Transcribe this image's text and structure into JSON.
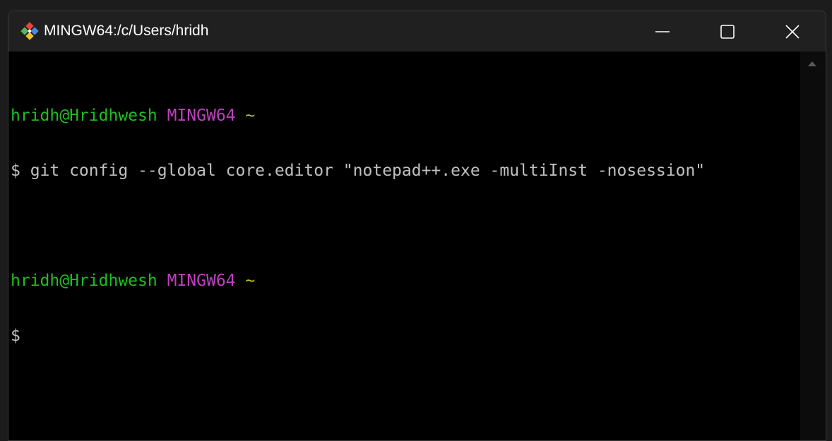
{
  "window": {
    "title": "MINGW64:/c/Users/hridh",
    "icon": "git-bash-icon"
  },
  "controls": {
    "minimize_icon": "minimize-icon",
    "maximize_icon": "maximize-icon",
    "close_icon": "close-icon"
  },
  "terminal": {
    "prompt1": {
      "user_host": "hridh@Hridhwesh",
      "space1": " ",
      "env": "MINGW64",
      "space2": " ",
      "path": "~"
    },
    "command1": "$ git config --global core.editor \"notepad++.exe -multiInst -nosession\"",
    "blank": "",
    "prompt2": {
      "user_host": "hridh@Hridhwesh",
      "space1": " ",
      "env": "MINGW64",
      "space2": " ",
      "path": "~"
    },
    "command2": "$"
  },
  "colors": {
    "user_host": "#1fbf1f",
    "env": "#bf3fbf",
    "path": "#bfbf1f",
    "text": "#c0c0c0",
    "background": "#000000",
    "titlebar": "#202020"
  }
}
